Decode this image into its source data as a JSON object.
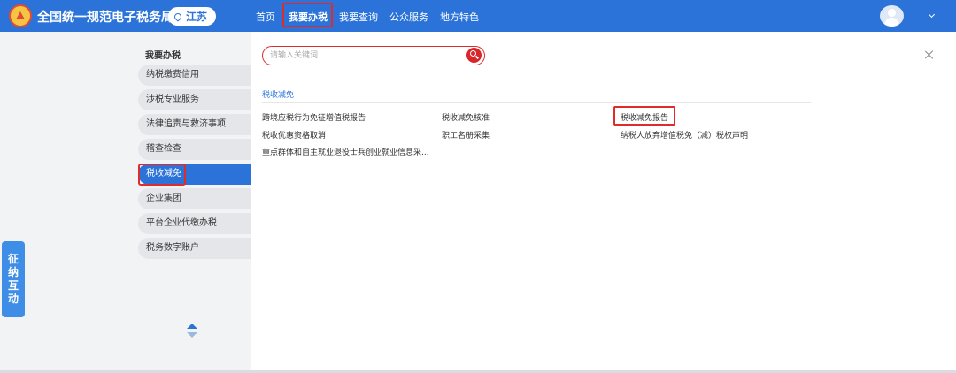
{
  "header": {
    "site_title": "全国统一规范电子税务局",
    "region": "江苏",
    "nav": [
      "首页",
      "我要办税",
      "我要查询",
      "公众服务",
      "地方特色"
    ],
    "active_nav": "我要办税"
  },
  "sidebar": {
    "title": "我要办税",
    "items": [
      "纳税缴费信用",
      "涉税专业服务",
      "法律追责与救济事项",
      "稽查检查",
      "税收减免",
      "企业集团",
      "平台企业代缴办税",
      "税务数字账户"
    ],
    "active_item": "税收减免"
  },
  "float_tab": [
    "征",
    "纳",
    "互",
    "动"
  ],
  "search": {
    "placeholder": "请输入关键词",
    "value": ""
  },
  "section": {
    "title": "税收减免",
    "links": [
      "跨境应税行为免征增值税报告",
      "税收减免核准",
      "税收减免报告",
      "税收优惠资格取消",
      "职工名册采集",
      "纳税人放弃增值税免（减）税权声明",
      "重点群体和自主就业退役士兵创业就业信息采..."
    ]
  },
  "icons": [
    "search-icon",
    "close-icon",
    "avatar-icon",
    "chevron-down-icon",
    "location-pin-icon",
    "arrow-up-icon",
    "arrow-down-icon"
  ],
  "colors": {
    "primary": "#2b73d9",
    "highlight_red": "#e02b2b",
    "sidebar_bg": "#f2f3f5"
  }
}
